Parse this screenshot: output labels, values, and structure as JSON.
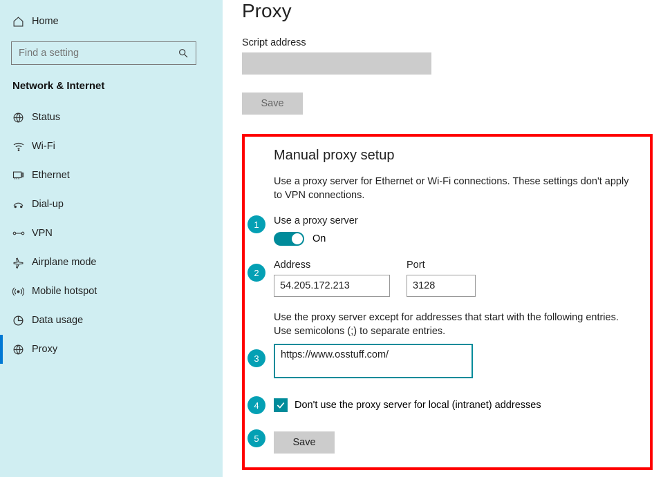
{
  "sidebar": {
    "home_label": "Home",
    "search_placeholder": "Find a setting",
    "category": "Network & Internet",
    "items": [
      {
        "label": "Status",
        "icon": "status-icon",
        "selected": false
      },
      {
        "label": "Wi-Fi",
        "icon": "wifi-icon",
        "selected": false
      },
      {
        "label": "Ethernet",
        "icon": "ethernet-icon",
        "selected": false
      },
      {
        "label": "Dial-up",
        "icon": "dialup-icon",
        "selected": false
      },
      {
        "label": "VPN",
        "icon": "vpn-icon",
        "selected": false
      },
      {
        "label": "Airplane mode",
        "icon": "airplane-icon",
        "selected": false
      },
      {
        "label": "Mobile hotspot",
        "icon": "hotspot-icon",
        "selected": false
      },
      {
        "label": "Data usage",
        "icon": "datausage-icon",
        "selected": false
      },
      {
        "label": "Proxy",
        "icon": "proxy-icon",
        "selected": true
      }
    ]
  },
  "main": {
    "page_title": "Proxy",
    "script_address_label": "Script address",
    "save1_label": "Save",
    "manual": {
      "heading": "Manual proxy setup",
      "desc": "Use a proxy server for Ethernet or Wi-Fi connections. These settings don't apply to VPN connections.",
      "use_proxy_label": "Use a proxy server",
      "toggle_state": "On",
      "address_label": "Address",
      "address_value": "54.205.172.213",
      "port_label": "Port",
      "port_value": "3128",
      "exceptions_desc": "Use the proxy server except for addresses that start with the following entries. Use semicolons (;) to separate entries.",
      "exceptions_value": "https://www.osstuff.com/",
      "local_checkbox_label": "Don't use the proxy server for local (intranet) addresses",
      "save2_label": "Save",
      "badges": [
        "1",
        "2",
        "3",
        "4",
        "5"
      ]
    }
  }
}
